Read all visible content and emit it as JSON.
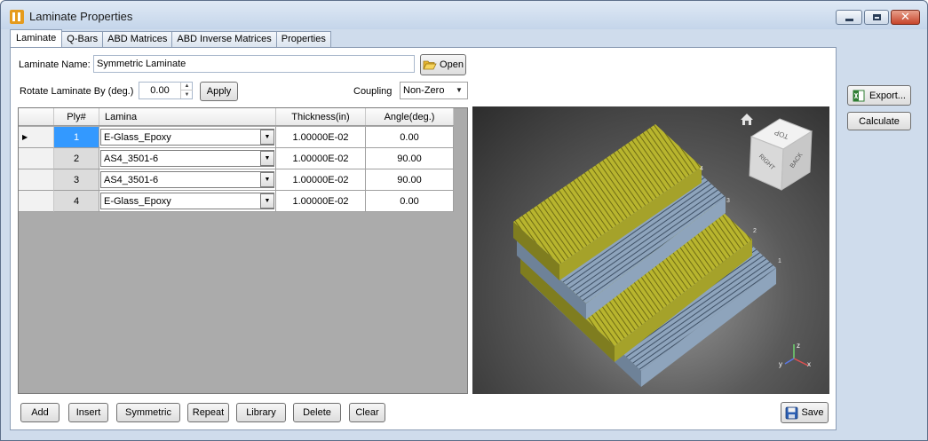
{
  "window": {
    "title": "Laminate Properties"
  },
  "tabs": [
    {
      "label": "Laminate",
      "active": true
    },
    {
      "label": "Q-Bars"
    },
    {
      "label": "ABD Matrices"
    },
    {
      "label": "ABD Inverse Matrices"
    },
    {
      "label": "Properties"
    }
  ],
  "form": {
    "name_label": "Laminate Name:",
    "name_value": "Symmetric Laminate",
    "open_label": "Open",
    "rotate_label": "Rotate Laminate By (deg.)",
    "rotate_value": "0.00",
    "apply_label": "Apply",
    "coupling_label": "Coupling",
    "coupling_value": "Non-Zero"
  },
  "grid": {
    "columns": [
      "Ply#",
      "Lamina",
      "Thickness(in)",
      "Angle(deg.)"
    ],
    "rows": [
      {
        "ply": "1",
        "lamina": "E-Glass_Epoxy",
        "thickness": "1.00000E-02",
        "angle": "0.00",
        "selected": true
      },
      {
        "ply": "2",
        "lamina": "AS4_3501-6",
        "thickness": "1.00000E-02",
        "angle": "90.00"
      },
      {
        "ply": "3",
        "lamina": "AS4_3501-6",
        "thickness": "1.00000E-02",
        "angle": "90.00"
      },
      {
        "ply": "4",
        "lamina": "E-Glass_Epoxy",
        "thickness": "1.00000E-02",
        "angle": "0.00"
      }
    ]
  },
  "viewer": {
    "ply_labels": [
      "4",
      "3",
      "2",
      "1"
    ],
    "cube_faces": {
      "top": "TOP",
      "right": "RIGHT",
      "back": "BACK"
    },
    "axes": {
      "z": "z",
      "y": "y",
      "x": "x"
    },
    "colors": {
      "glass": "#b8b52e",
      "carbon": "#8ea4bc",
      "background": "#3c3c3c"
    }
  },
  "bottom_buttons": {
    "add": "Add",
    "insert": "Insert",
    "symmetric": "Symmetric",
    "repeat": "Repeat",
    "library": "Library",
    "delete": "Delete",
    "clear": "Clear",
    "save": "Save"
  },
  "side_buttons": {
    "export": "Export...",
    "calculate": "Calculate"
  }
}
